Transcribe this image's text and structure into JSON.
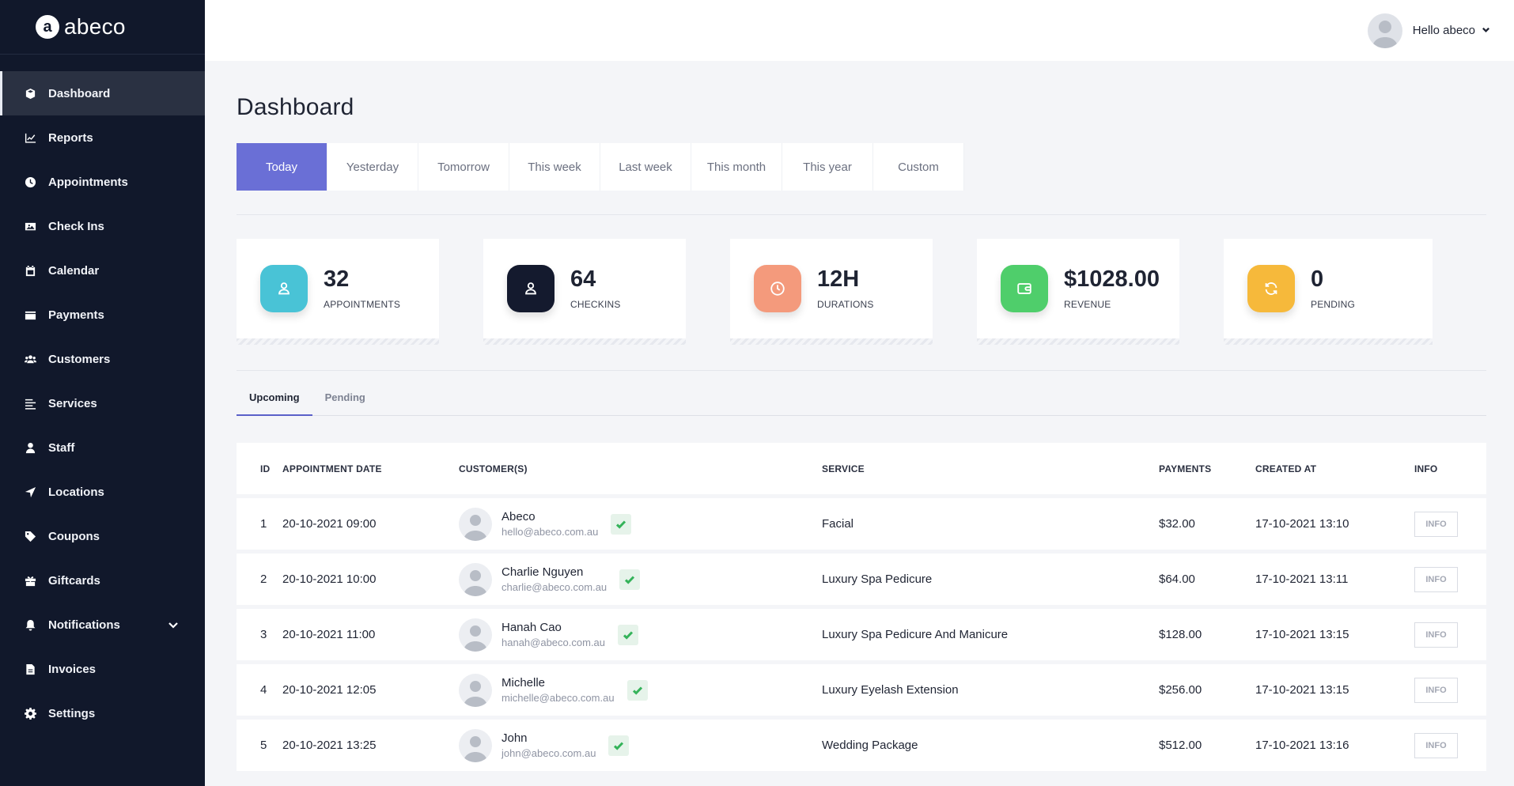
{
  "brand": {
    "mark": "a",
    "name": "abeco"
  },
  "sidebar": {
    "items": [
      {
        "label": "Dashboard",
        "icon": "box-icon",
        "active": true
      },
      {
        "label": "Reports",
        "icon": "chart-line-icon"
      },
      {
        "label": "Appointments",
        "icon": "clock-icon"
      },
      {
        "label": "Check Ins",
        "icon": "image-icon"
      },
      {
        "label": "Calendar",
        "icon": "calendar-icon"
      },
      {
        "label": "Payments",
        "icon": "wallet-icon"
      },
      {
        "label": "Customers",
        "icon": "users-icon"
      },
      {
        "label": "Services",
        "icon": "list-icon"
      },
      {
        "label": "Staff",
        "icon": "user-icon"
      },
      {
        "label": "Locations",
        "icon": "location-arrow-icon"
      },
      {
        "label": "Coupons",
        "icon": "tag-icon"
      },
      {
        "label": "Giftcards",
        "icon": "gift-icon"
      },
      {
        "label": "Notifications",
        "icon": "bell-icon",
        "has_chevron": true
      },
      {
        "label": "Invoices",
        "icon": "file-icon"
      },
      {
        "label": "Settings",
        "icon": "gear-icon"
      }
    ]
  },
  "topbar": {
    "greeting": "Hello abeco"
  },
  "page": {
    "title": "Dashboard"
  },
  "ranges": [
    "Today",
    "Yesterday",
    "Tomorrow",
    "This week",
    "Last week",
    "This month",
    "This year",
    "Custom"
  ],
  "stats": [
    {
      "value": "32",
      "label": "APPOINTMENTS",
      "color": "#49c3d6",
      "icon": "user-icon"
    },
    {
      "value": "64",
      "label": "CHECKINS",
      "color": "#141a2e",
      "icon": "user-icon"
    },
    {
      "value": "12H",
      "label": "DURATIONS",
      "color": "#f49a7c",
      "icon": "clock-icon"
    },
    {
      "value": "$1028.00",
      "label": "REVENUE",
      "color": "#4fce6b",
      "icon": "wallet-icon"
    },
    {
      "value": "0",
      "label": "PENDING",
      "color": "#f6b93b",
      "icon": "refresh-icon"
    }
  ],
  "tabs": [
    "Upcoming",
    "Pending"
  ],
  "table": {
    "headers": [
      "ID",
      "APPOINTMENT DATE",
      "CUSTOMER(S)",
      "SERVICE",
      "PAYMENTS",
      "CREATED AT",
      "INFO"
    ],
    "info_label": "INFO",
    "rows": [
      {
        "id": "1",
        "date": "20-10-2021 09:00",
        "name": "Abeco",
        "email": "hello@abeco.com.au",
        "service": "Facial",
        "payment": "$32.00",
        "created": "17-10-2021 13:10"
      },
      {
        "id": "2",
        "date": "20-10-2021 10:00",
        "name": "Charlie Nguyen",
        "email": "charlie@abeco.com.au",
        "service": "Luxury Spa Pedicure",
        "payment": "$64.00",
        "created": "17-10-2021 13:11"
      },
      {
        "id": "3",
        "date": "20-10-2021 11:00",
        "name": "Hanah Cao",
        "email": "hanah@abeco.com.au",
        "service": "Luxury Spa Pedicure And Manicure",
        "payment": "$128.00",
        "created": "17-10-2021 13:15"
      },
      {
        "id": "4",
        "date": "20-10-2021 12:05",
        "name": "Michelle",
        "email": "michelle@abeco.com.au",
        "service": "Luxury Eyelash Extension",
        "payment": "$256.00",
        "created": "17-10-2021 13:15"
      },
      {
        "id": "5",
        "date": "20-10-2021 13:25",
        "name": "John",
        "email": "john@abeco.com.au",
        "service": "Wedding Package",
        "payment": "$512.00",
        "created": "17-10-2021 13:16"
      }
    ]
  }
}
